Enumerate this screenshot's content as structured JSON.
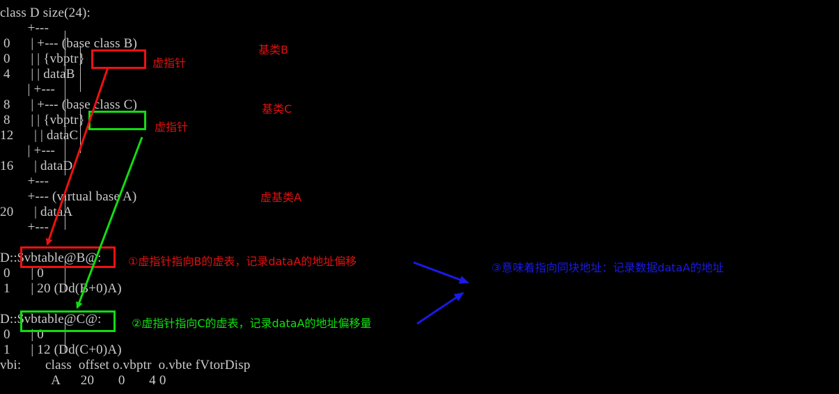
{
  "terminal": {
    "lines": {
      "l01": "class D size(24):",
      "l02": "        +---",
      "l03": " 0      | +--- (base class B)",
      "l04": " 0      | | {vbptr}",
      "l05": " 4      | | dataB",
      "l06": "        | +---",
      "l07": " 8      | +--- (base class C)",
      "l08": " 8      | | {vbptr}",
      "l09": "12      | | dataC",
      "l10": "        | +---",
      "l11": "16      | dataD",
      "l12": "        +---",
      "l13": "        +--- (virtual base A)",
      "l14": "20      | dataA",
      "l15": "        +---",
      "l16": "",
      "l17": "D::$vbtable@B@:",
      "l18": " 0      | 0",
      "l19": " 1      | 20 (Dd(B+0)A)",
      "l20": "",
      "l21": "D::$vbtable@C@:",
      "l22": " 0      | 0",
      "l23": " 1      | 12 (Dd(C+0)A)",
      "l24": "vbi:       class  offset o.vbptr  o.vbte fVtorDisp",
      "l25": "               A      20       0       4 0"
    }
  },
  "annotations": {
    "base_b": "基类B",
    "vptr_b": "虚指针",
    "base_c": "基类C",
    "vptr_c": "虚指针",
    "virtual_base_a": "虚基类A",
    "note_b": "①虚指针指向B的虚表，记录dataA的地址偏移",
    "note_c": "②虚指针指向C的虚表，记录dataA的地址偏移量",
    "note_same": "③意味着指向同块地址：记录数据dataA的地址"
  },
  "colors": {
    "background": "#000000",
    "text": "#cccccc",
    "red": "#ee1111",
    "green": "#11dd11",
    "blue": "#1a1ae6"
  }
}
